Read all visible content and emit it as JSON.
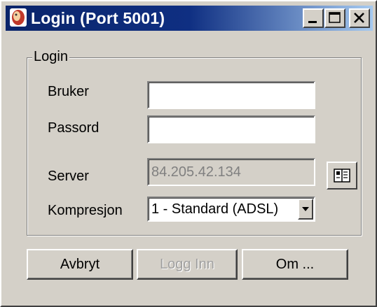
{
  "window": {
    "title": "Login (Port 5001)"
  },
  "group": {
    "title": "Login"
  },
  "form": {
    "user_label": "Bruker",
    "user_value": "",
    "password_label": "Passord",
    "password_value": "",
    "server_label": "Server",
    "server_value": "84.205.42.134",
    "compression_label": "Kompresjon",
    "compression_selected": "1 - Standard (ADSL)"
  },
  "buttons": {
    "cancel": "Avbryt",
    "login": "Logg Inn",
    "about": "Om ..."
  },
  "icons": {
    "app": "app-icon",
    "minimize": "minimize-icon",
    "maximize": "maximize-icon",
    "close": "close-icon",
    "server_list": "address-book-icon",
    "dropdown": "chevron-down-icon"
  },
  "colors": {
    "titlebar_start": "#0a246a",
    "titlebar_end": "#a6caf0",
    "face": "#d4d0c8"
  }
}
